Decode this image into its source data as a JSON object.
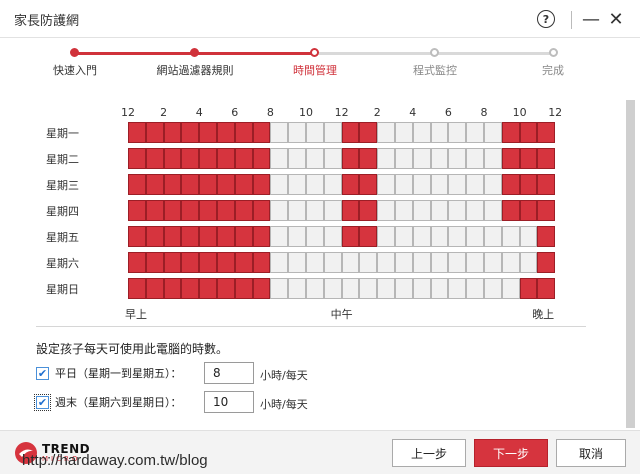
{
  "window": {
    "title": "家長防護網",
    "help_label": "?",
    "minimize_label": "—",
    "close_label": "✕"
  },
  "steps": [
    {
      "label": "快速入門",
      "state": "done"
    },
    {
      "label": "網站過濾器規則",
      "state": "done"
    },
    {
      "label": "時間管理",
      "state": "active"
    },
    {
      "label": "程式監控",
      "state": "todo"
    },
    {
      "label": "完成",
      "state": "todo"
    }
  ],
  "schedule": {
    "hour_labels": [
      "12",
      "2",
      "4",
      "6",
      "8",
      "10",
      "12",
      "2",
      "4",
      "6",
      "8",
      "10",
      "12"
    ],
    "days": [
      {
        "label": "星期一",
        "allowed_hours": [
          0,
          1,
          2,
          3,
          4,
          5,
          6,
          7,
          12,
          13,
          21,
          22,
          23
        ]
      },
      {
        "label": "星期二",
        "allowed_hours": [
          0,
          1,
          2,
          3,
          4,
          5,
          6,
          7,
          12,
          13,
          21,
          22,
          23
        ]
      },
      {
        "label": "星期三",
        "allowed_hours": [
          0,
          1,
          2,
          3,
          4,
          5,
          6,
          7,
          12,
          13,
          21,
          22,
          23
        ]
      },
      {
        "label": "星期四",
        "allowed_hours": [
          0,
          1,
          2,
          3,
          4,
          5,
          6,
          7,
          12,
          13,
          21,
          22,
          23
        ]
      },
      {
        "label": "星期五",
        "allowed_hours": [
          0,
          1,
          2,
          3,
          4,
          5,
          6,
          7,
          12,
          13,
          23
        ]
      },
      {
        "label": "星期六",
        "allowed_hours": [
          0,
          1,
          2,
          3,
          4,
          5,
          6,
          7,
          23
        ]
      },
      {
        "label": "星期日",
        "allowed_hours": [
          0,
          1,
          2,
          3,
          4,
          5,
          6,
          7,
          22,
          23
        ]
      }
    ],
    "axis_labels": {
      "morning": "早上",
      "noon": "中午",
      "night": "晚上"
    }
  },
  "usage": {
    "question": "設定孩子每天可使用此電腦的時數。",
    "weekday": {
      "label": "平日（星期一到星期五）：",
      "value": "8",
      "unit": "小時/每天",
      "checked": true
    },
    "weekend": {
      "label": "週末（星期六到星期日）：",
      "value": "10",
      "unit": "小時/每天",
      "checked": true
    }
  },
  "footer": {
    "brand": "TREND",
    "brand_sub": "MICRO",
    "back_label": "上一步",
    "next_label": "下一步",
    "cancel_label": "取消",
    "watermark": "http://hardaway.com.tw/blog"
  },
  "colors": {
    "accent": "#d6343e",
    "grid_off": "#f1f1f1"
  }
}
